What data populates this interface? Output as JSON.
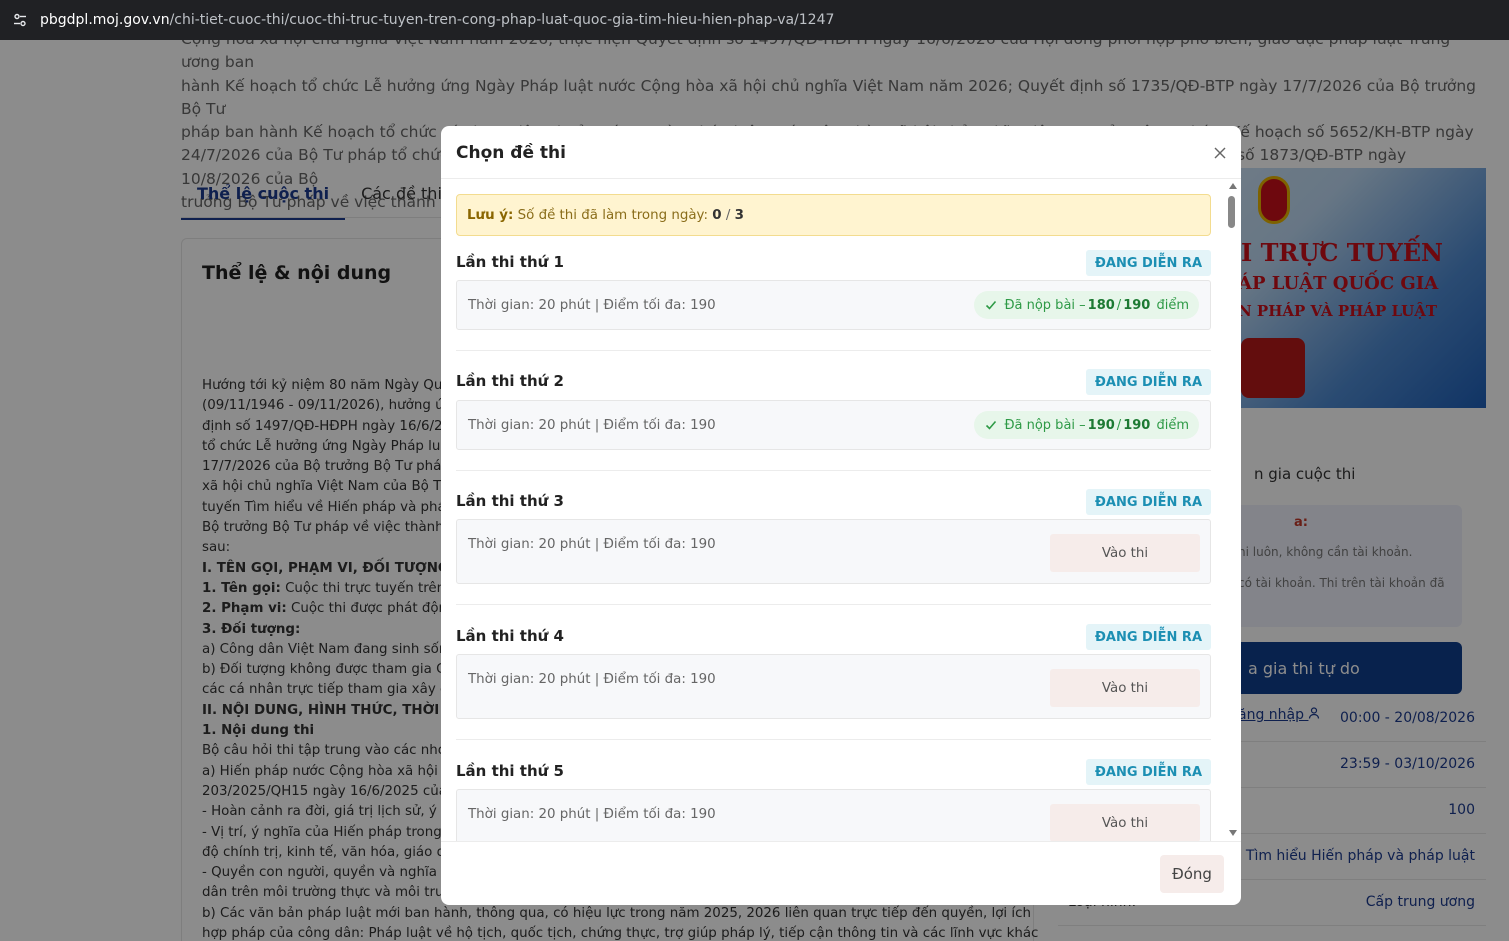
{
  "browser": {
    "host": "pbgdpl.moj.gov.vn",
    "path": "/chi-tiet-cuoc-thi/cuoc-thi-truc-tuyen-tren-cong-phap-luat-quoc-gia-tim-hieu-hien-phap-va/1247"
  },
  "background": {
    "intro_lines": [
      "Cộng hòa xã hội chủ nghĩa Việt Nam năm 2026; thực hiện Quyết định số 1497/QĐ-HĐPH ngày 16/6/2026 của Hội đồng phối hợp phổ biến, giáo dục pháp luật Trung ương ban",
      "hành Kế hoạch tổ chức Lễ hưởng ứng Ngày Pháp luật nước Cộng hòa xã hội chủ nghĩa Việt Nam năm 2026; Quyết định số 1735/QĐ-BTP ngày 17/7/2026 của Bộ trưởng Bộ Tư",
      "pháp ban hành Kế hoạch tổ chức các hoạt động hưởng ứng Ngày Pháp luật nước Cộng hòa xã hội chủ nghĩa Việt Nam của Bộ Tư pháp; Kế hoạch số 5652/KH-BTP ngày",
      "24/7/2026 của Bộ Tư pháp tổ chức Cuộc thi trực tuyến Tìm hiểu về Hiến pháp và pháp luật (sau đây gọi là Cuộc thi). Căn cứ Quyết định số 1873/QĐ-BTP ngày 10/8/2026 của Bộ",
      "trưởng Bộ Tư pháp về việc thành lập"
    ],
    "tabs": [
      "Thể lệ cuộc thi",
      "Các đề thi"
    ],
    "rules_title": "Thể lệ & nội dung",
    "rules_lines": [
      {
        "bold": "",
        "text": "Hướng tới kỷ niệm 80 năm Ngày Quốc"
      },
      {
        "bold": "",
        "text": "(09/11/1946 - 09/11/2026), hưởng ứng"
      },
      {
        "bold": "",
        "text": "định số 1497/QĐ-HĐPH ngày 16/6/20"
      },
      {
        "bold": "",
        "text": "tổ chức Lễ hưởng ứng Ngày Pháp luật"
      },
      {
        "bold": "",
        "text": "17/7/2026 của Bộ trưởng Bộ Tư pháp"
      },
      {
        "bold": "",
        "text": "xã hội chủ nghĩa Việt Nam của Bộ Tư"
      },
      {
        "bold": "",
        "text": "tuyến Tìm hiểu về Hiến pháp và pháp"
      },
      {
        "bold": "",
        "text": "Bộ trưởng Bộ Tư pháp về việc thành lậ"
      },
      {
        "bold": "",
        "text": "sau:"
      },
      {
        "bold": "I. TÊN GỌI, PHẠM VI, ĐỐI TƯỢNG THA",
        "text": ""
      },
      {
        "bold": "1. Tên gọi:",
        "text": " Cuộc thi trực tuyến trên Cổ"
      },
      {
        "bold": "2. Phạm vi:",
        "text": " Cuộc thi được phát động"
      },
      {
        "bold": "3. Đối tượng:",
        "text": ""
      },
      {
        "bold": "",
        "text": "a) Công dân Việt Nam đang sinh sống"
      },
      {
        "bold": "",
        "text": "b) Đối tượng không được tham gia Cu"
      },
      {
        "bold": "",
        "text": "các cá nhân trực tiếp tham gia xây d"
      },
      {
        "bold": "II. NỘI DUNG, HÌNH THỨC, THỜI GIAN",
        "text": ""
      },
      {
        "bold": "1. Nội dung thi",
        "text": ""
      },
      {
        "bold": "",
        "text": "Bộ câu hỏi thi tập trung vào các nhón"
      },
      {
        "bold": "",
        "text": "a) Hiến pháp nước Cộng hòa xã hội c"
      },
      {
        "bold": "",
        "text": "203/2025/QH15 ngày 16/6/2025 của"
      },
      {
        "bold": "",
        "text": "- Hoàn cảnh ra đời, giá trị lịch sử, ý ng"
      },
      {
        "bold": "",
        "text": "- Vị trí, ý nghĩa của Hiến pháp trong h"
      },
      {
        "bold": "",
        "text": "độ chính trị, kinh tế, văn hóa, giáo dục"
      },
      {
        "bold": "",
        "text": "- Quyền con người, quyền và nghĩa vụ"
      },
      {
        "bold": "",
        "text": "dân trên môi trường thực và môi trườn"
      },
      {
        "bold": "",
        "text": "b) Các văn bản pháp luật mới ban hành, thông qua, có hiệu lực trong năm 2025, 2026 liên quan trực tiếp đến quyền, lợi ích"
      },
      {
        "bold": "",
        "text": "hợp pháp của công dân: Pháp luật về hộ tịch, quốc tịch, chứng thực, trợ giúp pháp lý, tiếp cận thông tin và các lĩnh vực khác"
      }
    ],
    "banner_lines": [
      "I TRỰC TUYẾN",
      "ÁP LUẬT QUỐC GIA",
      "N PHÁP VÀ PHÁP LUẬT"
    ],
    "join_text": "n gia cuộc thi",
    "note_title": "a:",
    "note_line1": "ni luôn, không cần tài khoản.",
    "note_line2": "có tài khoản. Thi trên tài khoản đã",
    "free_button": "a gia thi tự do",
    "login_link": "ăng nhập",
    "info_rows": [
      {
        "key": "",
        "value": "00:00 - 20/08/2026"
      },
      {
        "key": "",
        "value": "23:59 - 03/10/2026"
      },
      {
        "key": "",
        "value": "100"
      },
      {
        "key": "",
        "value": "Tìm hiểu Hiến pháp và pháp luật"
      },
      {
        "key": "Loại hình:",
        "value": "Cấp trung ương"
      }
    ]
  },
  "modal": {
    "title": "Chọn đề thi",
    "warning": {
      "label": "Lưu ý:",
      "text": " Số đề thi đã làm trong ngày: ",
      "done": "0",
      "slash": " / ",
      "limit": "3"
    },
    "attempts": [
      {
        "title": "Lần thi thứ 1",
        "badge": "ĐANG DIỄN RA",
        "info": "Thời gian: 20 phút | Điểm tối đa: 190",
        "status": "submitted",
        "submitted_label": "Đã nộp bài – ",
        "score": "180",
        "slash": "/",
        "max": "190",
        "unit": "điểm"
      },
      {
        "title": "Lần thi thứ 2",
        "badge": "ĐANG DIỄN RA",
        "info": "Thời gian: 20 phút | Điểm tối đa: 190",
        "status": "submitted",
        "submitted_label": "Đã nộp bài – ",
        "score": "190",
        "slash": "/",
        "max": "190",
        "unit": "điểm"
      },
      {
        "title": "Lần thi thứ 3",
        "badge": "ĐANG DIỄN RA",
        "info": "Thời gian: 20 phút | Điểm tối đa: 190",
        "status": "open",
        "button": "Vào thi"
      },
      {
        "title": "Lần thi thứ 4",
        "badge": "ĐANG DIỄN RA",
        "info": "Thời gian: 20 phút | Điểm tối đa: 190",
        "status": "open",
        "button": "Vào thi"
      },
      {
        "title": "Lần thi thứ 5",
        "badge": "ĐANG DIỄN RA",
        "info": "Thời gian: 20 phút | Điểm tối đa: 190",
        "status": "open",
        "button": "Vào thi"
      }
    ],
    "close_button": "Đóng"
  },
  "colors": {
    "accent": "#1d3b8f",
    "badge_text": "#1c8fb3",
    "badge_bg": "#e4f4f8",
    "success": "#2e9a46",
    "warning_bg": "#fff4d0"
  }
}
